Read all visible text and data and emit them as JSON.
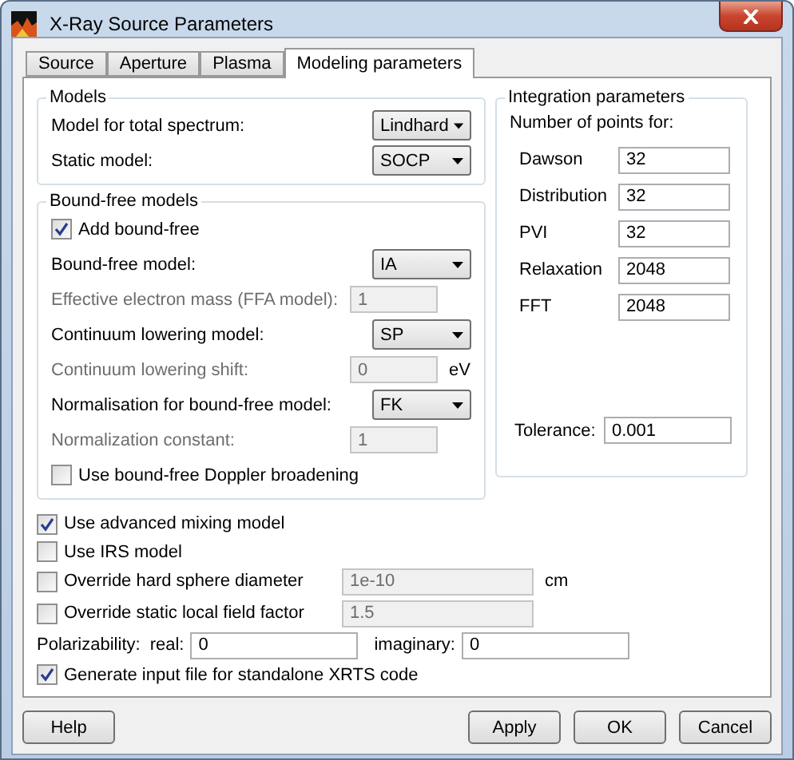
{
  "window": {
    "title": "X-Ray Source Parameters"
  },
  "tabs": [
    {
      "label": "Source",
      "selected": false
    },
    {
      "label": "Aperture",
      "selected": false
    },
    {
      "label": "Plasma",
      "selected": false
    },
    {
      "label": "Modeling parameters",
      "selected": true
    }
  ],
  "models": {
    "title": "Models",
    "rows": [
      {
        "kind": "dropdown",
        "label": "Model for total spectrum:",
        "value": "Lindhard",
        "disabled": false
      },
      {
        "kind": "dropdown",
        "label": "Static model:",
        "value": "SOCP",
        "disabled": false
      }
    ]
  },
  "bound_free_models": {
    "title": "Bound-free models",
    "rows": [
      {
        "kind": "checkbox",
        "label": "Add bound-free",
        "checked": true
      },
      {
        "kind": "dropdown",
        "label": "Bound-free model:",
        "value": "IA",
        "disabled": false
      },
      {
        "kind": "field",
        "label": "Effective electron mass (FFA model):",
        "value": "1",
        "disabled": true
      },
      {
        "kind": "dropdown",
        "label": "Continuum lowering model:",
        "value": "SP",
        "disabled": false
      },
      {
        "kind": "field",
        "label": "Continuum lowering shift:",
        "value": "0",
        "disabled": true,
        "unit": "eV"
      },
      {
        "kind": "dropdown",
        "label": "Normalisation for bound-free model:",
        "value": "FK",
        "disabled": false
      },
      {
        "kind": "field",
        "label": "Normalization constant:",
        "value": "1",
        "disabled": true
      },
      {
        "kind": "checkbox",
        "label": "Use bound-free Doppler broadening",
        "checked": false
      }
    ]
  },
  "integration_parameters": {
    "title": "Integration parameters",
    "subtitle": "Number of points for:",
    "fields": [
      {
        "label": "Dawson",
        "value": "32"
      },
      {
        "label": "Distribution",
        "value": "32"
      },
      {
        "label": "PVI",
        "value": "32"
      },
      {
        "label": "Relaxation",
        "value": "2048"
      },
      {
        "label": "FFT",
        "value": "2048"
      }
    ],
    "tolerance": {
      "label": "Tolerance:",
      "value": "0.001"
    }
  },
  "options": [
    {
      "kind": "checkbox",
      "label": "Use advanced mixing model",
      "checked": true
    },
    {
      "kind": "checkbox",
      "label": "Use IRS model",
      "checked": false
    },
    {
      "kind": "checkbox_field",
      "label": "Override hard sphere diameter",
      "checked": false,
      "value": "1e-10",
      "disabled": true,
      "unit": "cm"
    },
    {
      "kind": "checkbox_field",
      "label": "Override static local field factor",
      "checked": false,
      "value": "1.5",
      "disabled": true
    },
    {
      "kind": "pair",
      "label": "Polarizability:",
      "fields": [
        {
          "label": "real:",
          "value": "0"
        },
        {
          "label": "imaginary:",
          "value": "0"
        }
      ]
    },
    {
      "kind": "checkbox",
      "label": "Generate input file for standalone XRTS code",
      "checked": true
    }
  ],
  "buttons": [
    {
      "label": "Help",
      "kind": "left"
    },
    {
      "label": "Apply",
      "kind": "right"
    },
    {
      "label": "OK",
      "kind": "right"
    },
    {
      "label": "Cancel",
      "kind": "right"
    }
  ]
}
